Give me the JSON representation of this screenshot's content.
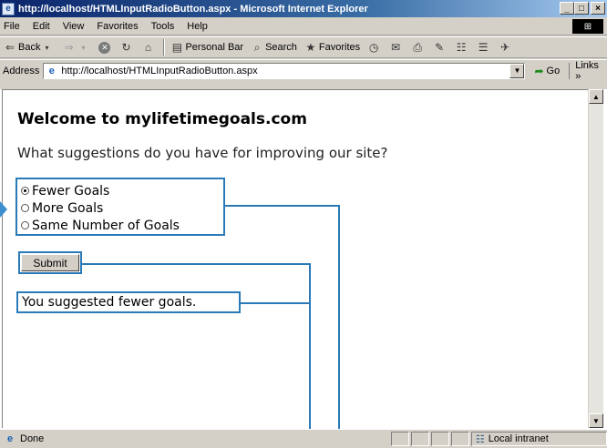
{
  "window": {
    "title": "http://localhost/HTMLInputRadioButton.aspx - Microsoft Internet Explorer",
    "app_icon": "ie-icon",
    "controls": [
      "_",
      "□",
      "×"
    ]
  },
  "menubar": {
    "items": [
      "File",
      "Edit",
      "View",
      "Favorites",
      "Tools",
      "Help"
    ]
  },
  "toolbar": {
    "back": "Back",
    "personal_bar": "Personal Bar",
    "search": "Search",
    "favorites": "Favorites"
  },
  "address": {
    "label": "Address",
    "url": "http://localhost/HTMLInputRadioButton.aspx",
    "go": "Go",
    "links": "Links »"
  },
  "page": {
    "title": "Welcome to mylifetimegoals.com",
    "question": "What suggestions do you have for improving our site?",
    "options": [
      {
        "label": "Fewer Goals",
        "selected": true
      },
      {
        "label": "More Goals",
        "selected": false
      },
      {
        "label": "Same Number of Goals",
        "selected": false
      }
    ],
    "submit_label": "Submit",
    "result": "You suggested fewer goals."
  },
  "status": {
    "text": "Done",
    "zone": "Local intranet"
  },
  "colors": {
    "callout": "#2a7ab8",
    "titlebar": "#0a246a",
    "chrome": "#d4d0c8"
  }
}
